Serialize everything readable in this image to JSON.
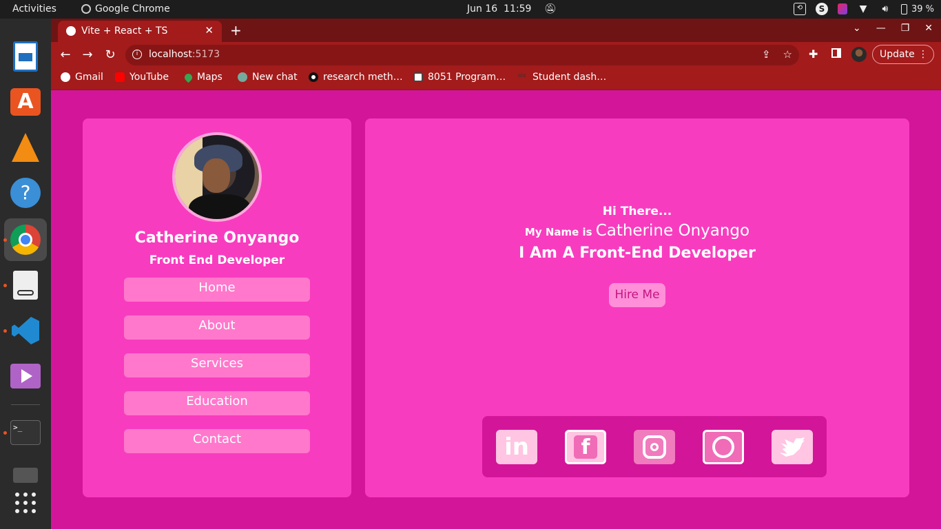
{
  "system_bar": {
    "activities": "Activities",
    "app_name": "Google Chrome",
    "date": "Jun 16",
    "time": "11:59",
    "battery": "39 %"
  },
  "browser": {
    "tab_title": "Vite + React + TS",
    "url_host": "localhost",
    "url_port": ":5173",
    "update_label": "Update",
    "bookmarks": [
      {
        "label": "Gmail",
        "color": "#ffffff"
      },
      {
        "label": "YouTube",
        "color": "#ff0000"
      },
      {
        "label": "Maps",
        "color": "#34a853"
      },
      {
        "label": "New chat",
        "color": "#74aa9c"
      },
      {
        "label": "research meth…",
        "color": "#ffffff"
      },
      {
        "label": "8051 Program…",
        "color": "#ffffff"
      },
      {
        "label": "Student dash…",
        "color": "#ffffff"
      }
    ]
  },
  "profile": {
    "name": "Catherine Onyango",
    "role": "Front End Developer"
  },
  "nav": {
    "items": [
      "Home",
      "About",
      "Services",
      "Education",
      "Contact"
    ]
  },
  "hero": {
    "greeting": "Hi There...",
    "name_prefix": "My Name is",
    "name": "Catherine Onyango",
    "title": "I Am A Front-End Developer",
    "hire_label": "Hire Me"
  },
  "social": [
    {
      "icon": "linkedin-icon",
      "label": "in"
    },
    {
      "icon": "facebook-icon",
      "label": "f"
    },
    {
      "icon": "instagram-icon",
      "label": ""
    },
    {
      "icon": "whatsapp-icon",
      "label": ""
    },
    {
      "icon": "twitter-icon",
      "label": ""
    }
  ],
  "colors": {
    "page_bg": "#d3159a",
    "card_bg": "#f83cbf",
    "nav_button": "#ff78cc",
    "hire_button": "#ff8fd8",
    "browser_frame": "#a31b1b"
  }
}
